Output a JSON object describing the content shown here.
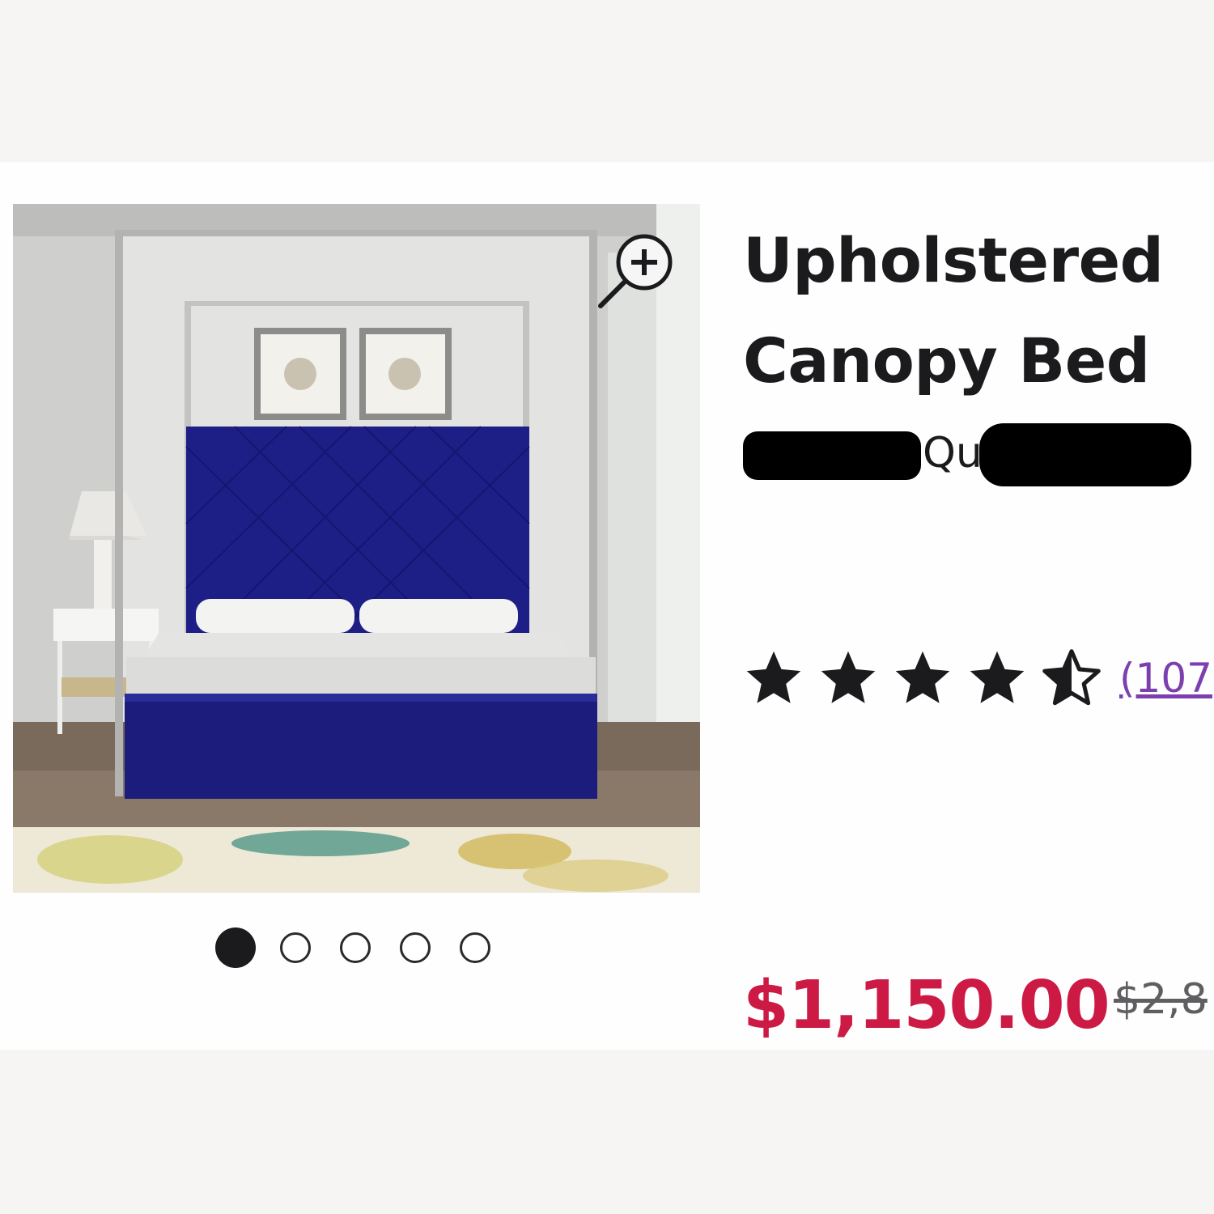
{
  "product": {
    "title": "Upholstered\nCanopy Bed",
    "brand_visible_fragment": "Qu",
    "rating": {
      "stars": 4.5,
      "max": 5,
      "review_count_text": "(107"
    },
    "price": {
      "sale": "$1,150.00",
      "original": "$2,8"
    }
  },
  "gallery": {
    "image_subject": "blue tufted upholstered canopy bed in bedroom",
    "zoom_icon": "zoom-in-icon",
    "dot_count": 5,
    "active_index": 0
  },
  "colors": {
    "price_sale": "#cc1a44",
    "link": "#7b3fb0",
    "text": "#1b1b1e",
    "page_bg": "#f7f5f3"
  }
}
